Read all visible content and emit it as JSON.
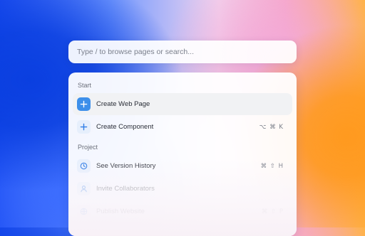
{
  "search": {
    "placeholder": "Type / to browse pages or search..."
  },
  "sections": {
    "start": "Start",
    "project": "Project"
  },
  "items": [
    {
      "label": "Create Web Page",
      "icon": "plus-icon",
      "shortcut": "",
      "active": true
    },
    {
      "label": "Create Component",
      "icon": "plus-icon",
      "shortcut": "⌥ ⌘ K"
    },
    {
      "label": "See Version History",
      "icon": "clock-icon",
      "shortcut": "⌘ ⇧ H"
    },
    {
      "label": "Invite Collaborators",
      "icon": "user-icon",
      "shortcut": ""
    },
    {
      "label": "Publish Website",
      "icon": "globe-icon",
      "shortcut": "⌘ ⇧ P"
    }
  ],
  "colors": {
    "accent": "#3d8fea",
    "icon_bg": "#e6effc",
    "active_row": "#f1f2f4"
  }
}
